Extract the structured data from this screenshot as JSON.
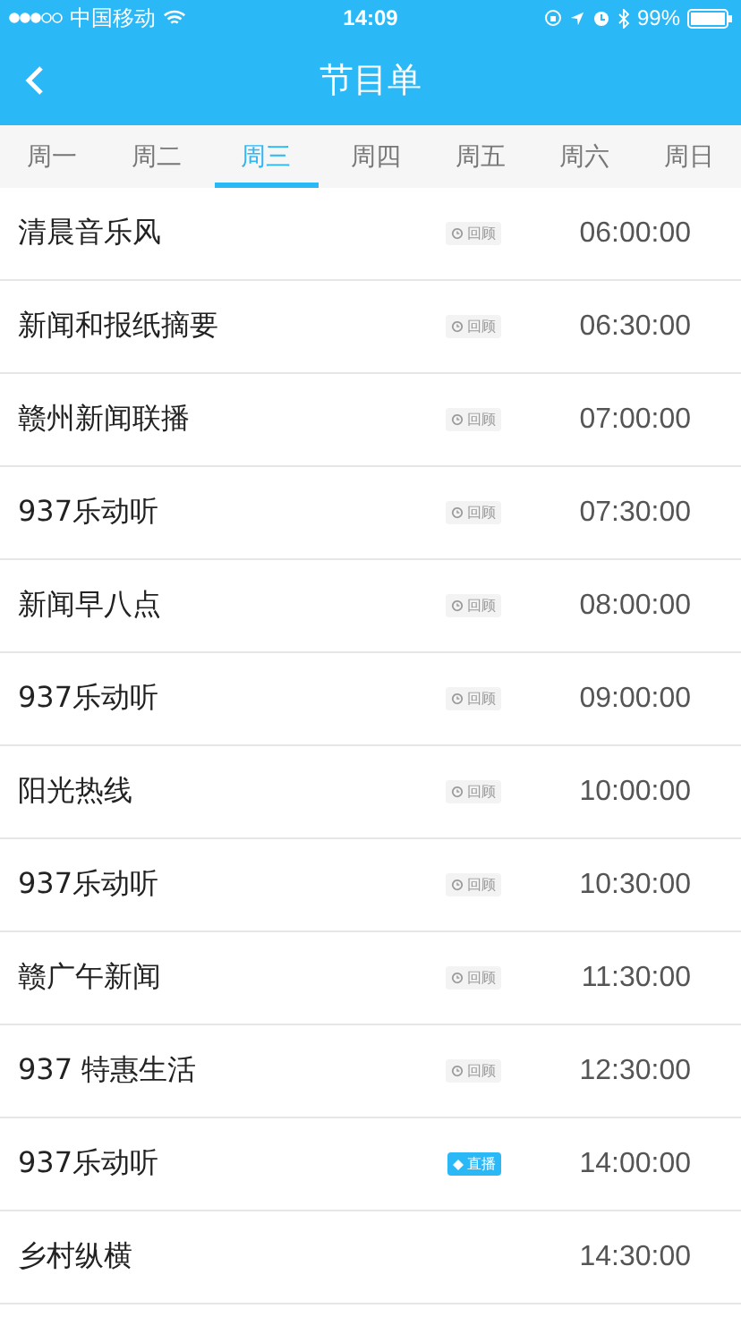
{
  "status_bar": {
    "carrier": "中国移动",
    "time": "14:09",
    "battery": "99%"
  },
  "header": {
    "title": "节目单"
  },
  "tabs": [
    {
      "label": "周一",
      "selected": false
    },
    {
      "label": "周二",
      "selected": false
    },
    {
      "label": "周三",
      "selected": true
    },
    {
      "label": "周四",
      "selected": false
    },
    {
      "label": "周五",
      "selected": false
    },
    {
      "label": "周六",
      "selected": false
    },
    {
      "label": "周日",
      "selected": false
    }
  ],
  "programs": [
    {
      "name": "清晨音乐风",
      "badge": {
        "kind": "replay",
        "label": "回顾"
      },
      "time": "06:00:00"
    },
    {
      "name": "新闻和报纸摘要",
      "badge": {
        "kind": "replay",
        "label": "回顾"
      },
      "time": "06:30:00"
    },
    {
      "name": "赣州新闻联播",
      "badge": {
        "kind": "replay",
        "label": "回顾"
      },
      "time": "07:00:00"
    },
    {
      "name": "937乐动听",
      "badge": {
        "kind": "replay",
        "label": "回顾"
      },
      "time": "07:30:00"
    },
    {
      "name": "新闻早八点",
      "badge": {
        "kind": "replay",
        "label": "回顾"
      },
      "time": "08:00:00"
    },
    {
      "name": "937乐动听",
      "badge": {
        "kind": "replay",
        "label": "回顾"
      },
      "time": "09:00:00"
    },
    {
      "name": "阳光热线",
      "badge": {
        "kind": "replay",
        "label": "回顾"
      },
      "time": "10:00:00"
    },
    {
      "name": "937乐动听",
      "badge": {
        "kind": "replay",
        "label": "回顾"
      },
      "time": "10:30:00"
    },
    {
      "name": "赣广午新闻",
      "badge": {
        "kind": "replay",
        "label": "回顾"
      },
      "time": "11:30:00"
    },
    {
      "name": "937 特惠生活",
      "badge": {
        "kind": "replay",
        "label": "回顾"
      },
      "time": "12:30:00"
    },
    {
      "name": "937乐动听",
      "badge": {
        "kind": "live",
        "label": "直播"
      },
      "time": "14:00:00"
    },
    {
      "name": "乡村纵横",
      "time": "14:30:00"
    }
  ]
}
